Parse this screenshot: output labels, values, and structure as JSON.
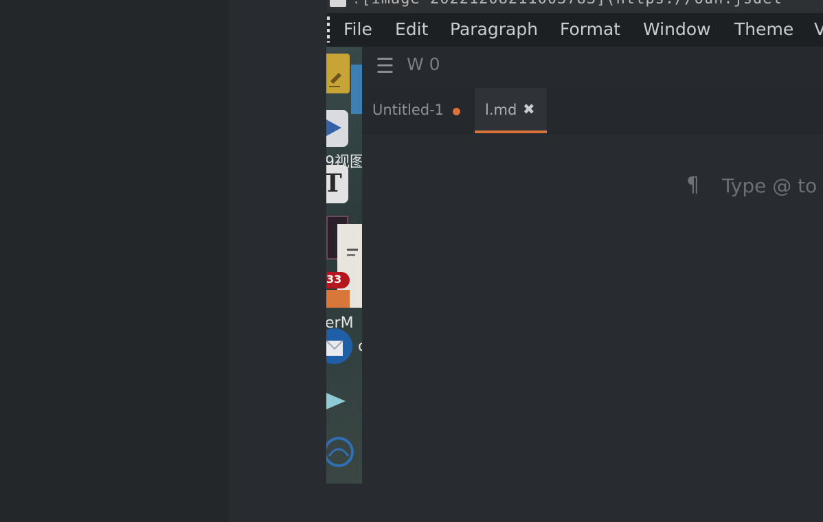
{
  "window": {
    "title": "![image-20221208211003783](https://oun.jsdel"
  },
  "menubar": {
    "items": [
      "File",
      "Edit",
      "Paragraph",
      "Format",
      "Window",
      "Theme",
      "V"
    ]
  },
  "dock": {
    "labels": [
      "9视图",
      "T",
      "33",
      "erM",
      "c"
    ],
    "apps": [
      "stickies-icon",
      "finder-icon",
      "mail-app-icon",
      "typora-icon",
      "terminal-icon",
      "document-preview-icon",
      "rss-reader-icon",
      "thunderbird-icon",
      "gpu-tool-icon",
      "globe-app-icon"
    ]
  },
  "editor": {
    "word_count": "W 0",
    "tabs": [
      {
        "label": "Untitled-1",
        "state": "unsaved"
      },
      {
        "label": "l.md",
        "state": "active"
      }
    ],
    "pilcrow": "¶",
    "placeholder": "Type @ to"
  },
  "colors": {
    "accent": "#d9733a",
    "background": "#282c30",
    "menubar": "#1d2023"
  }
}
